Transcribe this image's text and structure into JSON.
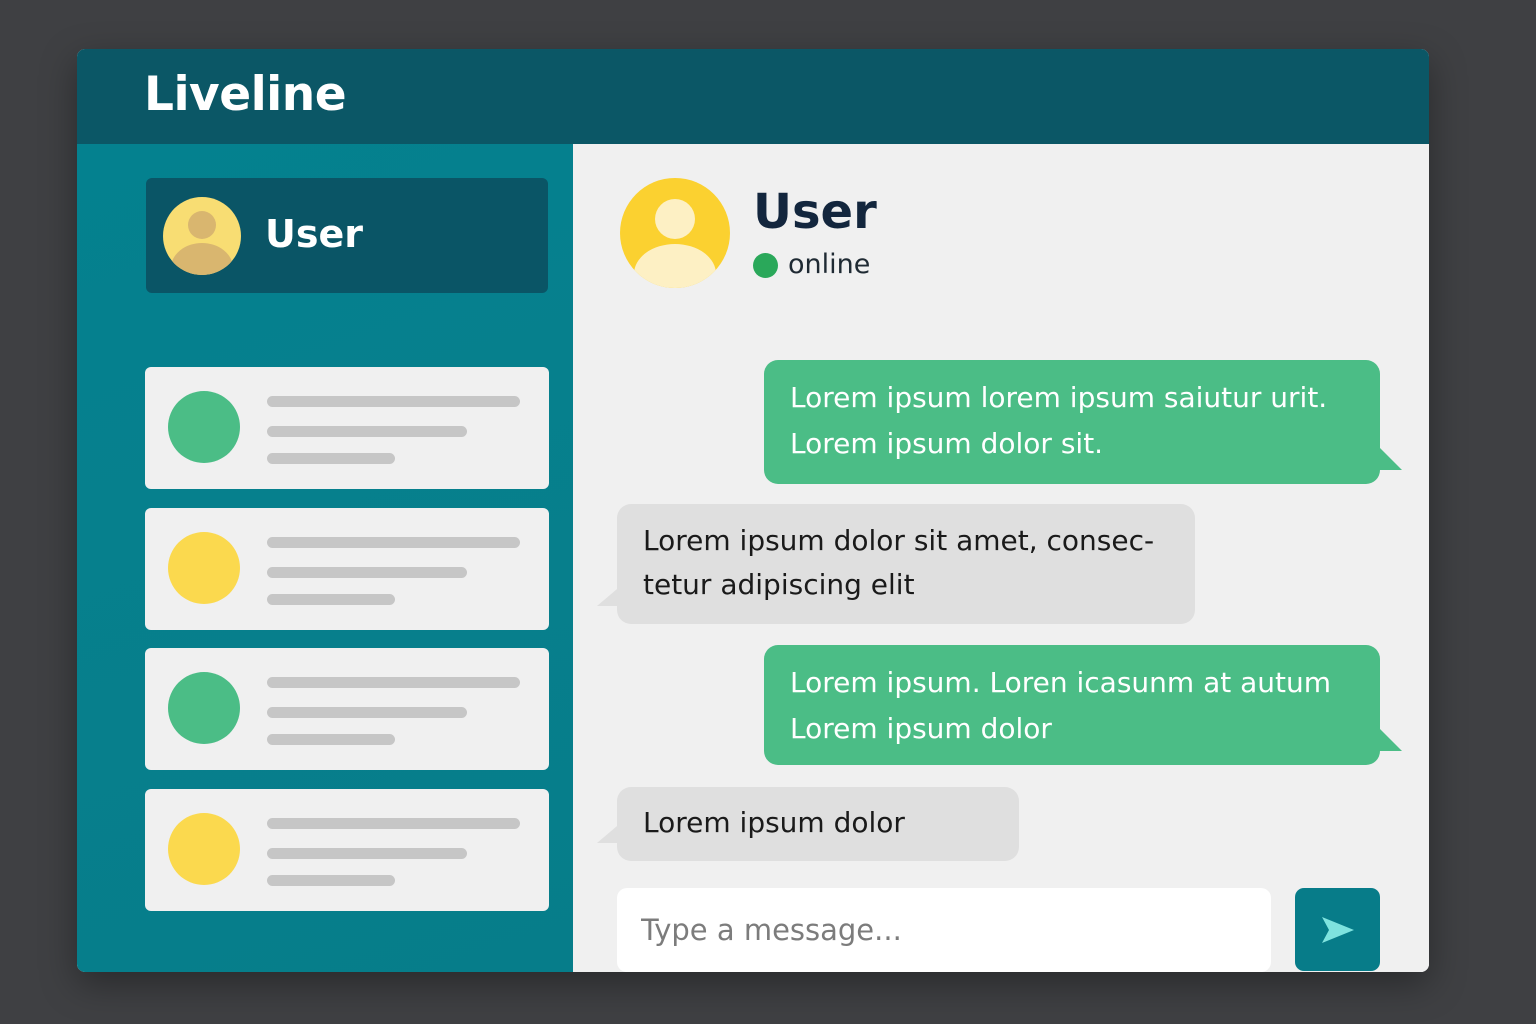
{
  "app": {
    "title": "Liveline"
  },
  "colors": {
    "header": "#0b5766",
    "sidebar": "#04818f",
    "outgoing_bubble": "#4bbd86",
    "incoming_bubble": "#dfdfdf",
    "online": "#2aa85a",
    "send_button": "#077c89",
    "avatar_yellow": "#fbd130",
    "avatar_green": "#4bbd86"
  },
  "sidebar": {
    "current_user": {
      "name": "User",
      "icon": "user-avatar-icon"
    },
    "contacts": [
      {
        "avatar_color": "#4bbd86"
      },
      {
        "avatar_color": "#fbd94e"
      },
      {
        "avatar_color": "#4bbd86"
      },
      {
        "avatar_color": "#fbd94e"
      }
    ]
  },
  "chat": {
    "user_name": "User",
    "status": "online",
    "avatar_icon": "user-avatar-icon",
    "messages": [
      {
        "direction": "out",
        "lines": [
          "Lorem ipsum lorem ipsum saiutur urit.",
          "Lorem ipsum dolor sit."
        ]
      },
      {
        "direction": "in",
        "lines": [
          "Lorem ipsum dolor sit amet, consec-",
          "tetur adipiscing elit"
        ]
      },
      {
        "direction": "out",
        "lines": [
          "Lorem ipsum. Loren icasunm at autum",
          "Lorem ipsum dolor"
        ]
      },
      {
        "direction": "in",
        "lines": [
          "Lorem ipsum dolor"
        ]
      }
    ],
    "composer": {
      "placeholder": "Type a message...",
      "value": "",
      "send_icon": "send-icon"
    }
  }
}
